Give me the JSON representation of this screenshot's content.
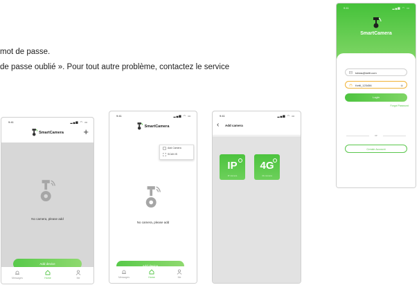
{
  "document": {
    "line1": "mot de passe.",
    "line2": "de passe oublié ». Pour tout autre problème, contactez le service"
  },
  "common": {
    "app_name": "SmartCamera",
    "time": "9:41",
    "status_icons": "▂▄▆ ◠ ▭"
  },
  "screen_home": {
    "empty_text": "No camera, please add",
    "add_button": "Add device",
    "tabs": [
      "Messages",
      "Home",
      "Me"
    ]
  },
  "screen_popup": {
    "menu_items": [
      "Add Camera",
      "SCAN IS"
    ],
    "empty_text": "No camera, please add",
    "add_button": "Add device",
    "tabs": [
      "Messages",
      "Home",
      "Me"
    ]
  },
  "screen_add": {
    "title": "Add camera",
    "tiles": [
      {
        "label": "IP",
        "sub": "IP camera"
      },
      {
        "label": "4G",
        "sub": "4G camera"
      }
    ]
  },
  "screen_login": {
    "brand": "SmartCamera",
    "email_value": "tobias@kettl.com",
    "password_value": "Kettl_123456",
    "login_button": "Login",
    "forgot_link": "Forgot Password",
    "or_text": "or",
    "create_button": "Create Account"
  },
  "colors": {
    "accent": "#55c647",
    "accent_light": "#8fd96f",
    "focus": "#f0b234",
    "placeholder_grey": "#d7d7d7"
  }
}
